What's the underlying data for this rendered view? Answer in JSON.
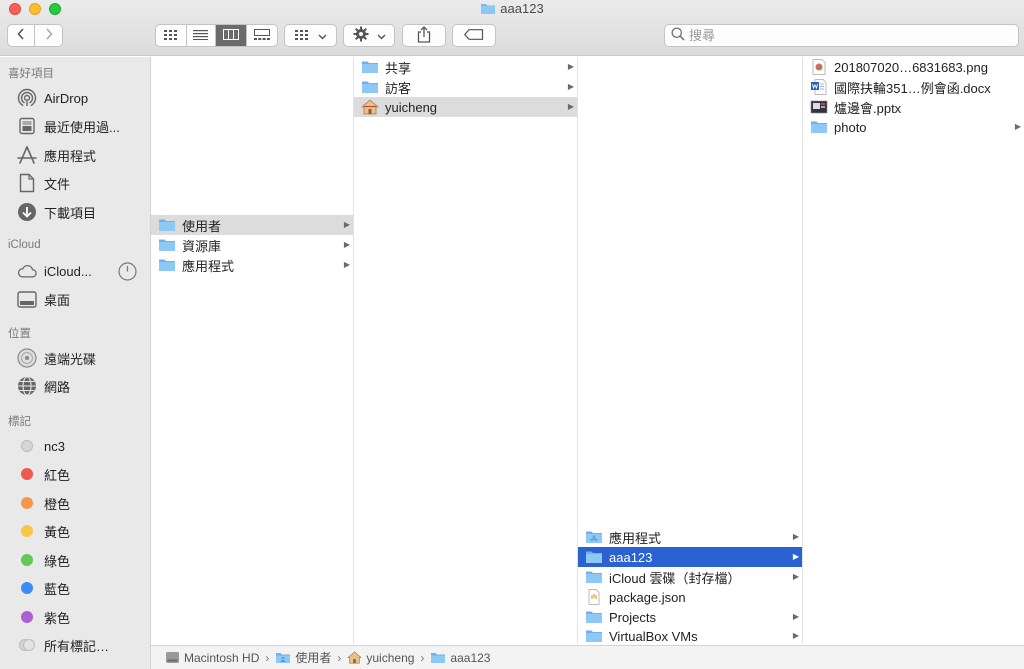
{
  "window": {
    "title": "aaa123"
  },
  "toolbar": {
    "search_placeholder": "搜尋"
  },
  "sidebar": {
    "favorites_header": "喜好項目",
    "favorites": [
      {
        "label": "AirDrop",
        "icon": "airdrop-icon"
      },
      {
        "label": "最近使用過...",
        "icon": "recents-icon"
      },
      {
        "label": "應用程式",
        "icon": "applications-icon"
      },
      {
        "label": "文件",
        "icon": "document-icon"
      },
      {
        "label": "下載項目",
        "icon": "downloads-icon"
      }
    ],
    "icloud_header": "iCloud",
    "icloud": [
      {
        "label": "iCloud...",
        "icon": "cloud-icon"
      },
      {
        "label": "桌面",
        "icon": "desktop-icon"
      }
    ],
    "locations_header": "位置",
    "locations": [
      {
        "label": "遠端光碟",
        "icon": "disc-icon"
      },
      {
        "label": "網路",
        "icon": "network-icon"
      }
    ],
    "tags_header": "標記",
    "tags": [
      {
        "label": "nc3",
        "color": "#d0d0d0"
      },
      {
        "label": "紅色",
        "color": "#ef5a4f"
      },
      {
        "label": "橙色",
        "color": "#f4974a"
      },
      {
        "label": "黃色",
        "color": "#f7c843"
      },
      {
        "label": "綠色",
        "color": "#63c859"
      },
      {
        "label": "藍色",
        "color": "#3c8cf7"
      },
      {
        "label": "紫色",
        "color": "#b05ed6"
      },
      {
        "label": "所有標記…",
        "color": "#cfcfcf"
      }
    ]
  },
  "columns": {
    "col1": [
      {
        "label": "使用者",
        "icon": "folder-icon",
        "selected": "grey"
      },
      {
        "label": "資源庫",
        "icon": "folder-icon"
      },
      {
        "label": "應用程式",
        "icon": "folder-icon"
      }
    ],
    "col2": [
      {
        "label": "共享",
        "icon": "folder-icon"
      },
      {
        "label": "訪客",
        "icon": "folder-icon"
      },
      {
        "label": "yuicheng",
        "icon": "home-icon",
        "selected": "grey"
      }
    ],
    "col3": [
      {
        "label": "應用程式",
        "icon": "folder-icon"
      },
      {
        "label": "aaa123",
        "icon": "folder-icon",
        "selected": "blue"
      },
      {
        "label": "iCloud 雲碟（封存檔）",
        "icon": "folder-icon"
      },
      {
        "label": "package.json",
        "icon": "json-file-icon"
      },
      {
        "label": "Projects",
        "icon": "folder-icon"
      },
      {
        "label": "VirtualBox VMs",
        "icon": "folder-icon"
      }
    ],
    "col4": [
      {
        "label": "201807020…6831683.png",
        "icon": "image-file-icon"
      },
      {
        "label": "國際扶輪351…例會函.docx",
        "icon": "word-file-icon"
      },
      {
        "label": "爐邊會.pptx",
        "icon": "pptx-file-icon"
      },
      {
        "label": "photo",
        "icon": "folder-icon"
      }
    ]
  },
  "pathbar": [
    "Macintosh HD",
    "使用者",
    "yuicheng",
    "aaa123"
  ]
}
